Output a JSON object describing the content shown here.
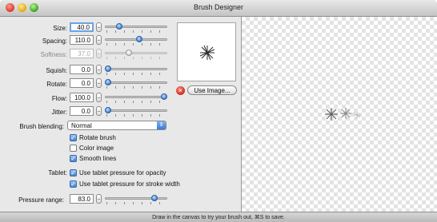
{
  "window": {
    "title": "Brush Designer"
  },
  "controls": [
    {
      "id": "size",
      "label": "Size:",
      "value": "40.0",
      "slider_fraction": 0.2,
      "focused": true,
      "disabled": false
    },
    {
      "id": "spacing",
      "label": "Spacing:",
      "value": "110.0",
      "slider_fraction": 0.55,
      "focused": false,
      "disabled": false
    },
    {
      "id": "softness",
      "label": "Softness:",
      "value": "37.0",
      "slider_fraction": 0.37,
      "focused": false,
      "disabled": true
    },
    {
      "id": "squish",
      "label": "Squish:",
      "value": "0.0",
      "slider_fraction": 0.0,
      "focused": false,
      "disabled": false
    },
    {
      "id": "rotate",
      "label": "Rotate:",
      "value": "0.0",
      "slider_fraction": 0.0,
      "focused": false,
      "disabled": false
    },
    {
      "id": "flow",
      "label": "Flow:",
      "value": "100.0",
      "slider_fraction": 1.0,
      "focused": false,
      "disabled": false
    },
    {
      "id": "jitter",
      "label": "Jitter:",
      "value": "0.0",
      "slider_fraction": 0.0,
      "focused": false,
      "disabled": false
    }
  ],
  "blending": {
    "label": "Brush blending:",
    "value": "Normal"
  },
  "options": [
    {
      "label": "Rotate brush",
      "checked": true
    },
    {
      "label": "Color image",
      "checked": false
    },
    {
      "label": "Smooth lines",
      "checked": true
    }
  ],
  "tablet": {
    "label": "Tablet:",
    "options": [
      {
        "label": "Use tablet pressure for opacity",
        "checked": true
      },
      {
        "label": "Use tablet pressure for stroke width",
        "checked": true
      }
    ]
  },
  "pressure": {
    "label": "Pressure range:",
    "value": "83.0",
    "slider_fraction": 0.83
  },
  "image": {
    "use_button": "Use Image..."
  },
  "status": {
    "text": "Draw in the canvas to try your brush out, ⌘S to save."
  }
}
